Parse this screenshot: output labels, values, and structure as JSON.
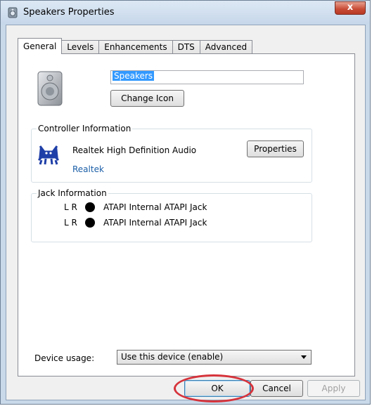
{
  "window": {
    "title": "Speakers Properties",
    "close_label": "x"
  },
  "tabs": [
    {
      "label": "General",
      "active": true
    },
    {
      "label": "Levels",
      "active": false
    },
    {
      "label": "Enhancements",
      "active": false
    },
    {
      "label": "DTS",
      "active": false
    },
    {
      "label": "Advanced",
      "active": false
    }
  ],
  "general": {
    "device_name": "Speakers",
    "change_icon_label": "Change Icon"
  },
  "controller": {
    "group_label": "Controller Information",
    "name": "Realtek High Definition Audio",
    "vendor_link": "Realtek",
    "properties_label": "Properties"
  },
  "jack": {
    "group_label": "Jack Information",
    "rows": [
      {
        "channels": "L R",
        "color": "#000000",
        "name": "ATAPI Internal ATAPI Jack"
      },
      {
        "channels": "L R",
        "color": "#000000",
        "name": "ATAPI Internal ATAPI Jack"
      }
    ]
  },
  "device_usage": {
    "label": "Device usage:",
    "selected": "Use this device (enable)"
  },
  "buttons": {
    "ok": "OK",
    "cancel": "Cancel",
    "apply": "Apply"
  },
  "colors": {
    "accent": "#3399ff",
    "link": "#1c5fa8",
    "highlight_ring": "#d6333b"
  }
}
